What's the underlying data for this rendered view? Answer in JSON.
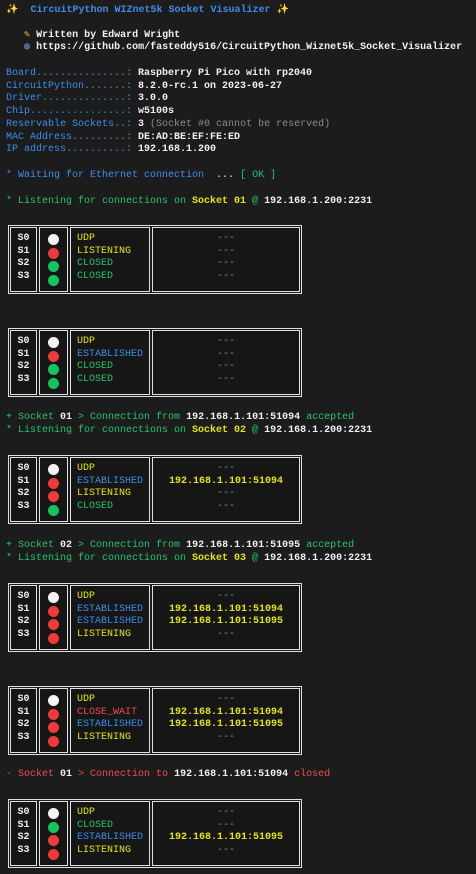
{
  "header": {
    "title": "CircuitPython WIZnet5k Socket Visualizer",
    "sparkle_icon": "sparkles",
    "author": "Written by Edward Wright",
    "pencil_icon": "pencil",
    "globe_icon": "globe",
    "url": "https://github.com/fasteddy516/CircuitPython_Wiznet5k_Socket_Visualizer"
  },
  "info": [
    {
      "label": "Board...............: ",
      "value": "Raspberry Pi Pico with rp2040",
      "note": ""
    },
    {
      "label": "CircuitPython.......: ",
      "value": "8.2.0-rc.1 on 2023-06-27",
      "note": ""
    },
    {
      "label": "Driver..............: ",
      "value": "3.0.0",
      "note": ""
    },
    {
      "label": "Chip................: ",
      "value": "w5100s",
      "note": ""
    },
    {
      "label": "Reservable Sockets..: ",
      "value": "3",
      "note": " (Socket #0 cannot be reserved)"
    },
    {
      "label": "MAC Address.........: ",
      "value": "DE:AD:BE:EF:FE:ED",
      "note": ""
    },
    {
      "label": "IP address..........: ",
      "value": "192.168.1.200",
      "note": ""
    }
  ],
  "waiting": {
    "text": "* Waiting for Ethernet connection ",
    "dots": " ... ",
    "ok": "[ OK ]"
  },
  "logs": [
    [
      {
        "t": "* Listening for connections on ",
        "c": "g"
      },
      {
        "t": "Socket 01",
        "c": "y"
      },
      {
        "t": " @ ",
        "c": "g"
      },
      {
        "t": "192.168.1.200:2231",
        "c": "w"
      }
    ],
    [
      {
        "t": "+ Socket ",
        "c": "g"
      },
      {
        "t": "01",
        "c": "w"
      },
      {
        "t": " > Connection from ",
        "c": "g"
      },
      {
        "t": "192.168.1.101:51094",
        "c": "w"
      },
      {
        "t": " accepted",
        "c": "g"
      }
    ],
    [
      {
        "t": "* Listening for connections on ",
        "c": "g"
      },
      {
        "t": "Socket 02",
        "c": "y"
      },
      {
        "t": " @ ",
        "c": "g"
      },
      {
        "t": "192.168.1.200:2231",
        "c": "w"
      }
    ],
    [
      {
        "t": "+ Socket ",
        "c": "g"
      },
      {
        "t": "02",
        "c": "w"
      },
      {
        "t": " > Connection from ",
        "c": "g"
      },
      {
        "t": "192.168.1.101:51095",
        "c": "w"
      },
      {
        "t": " accepted",
        "c": "g"
      }
    ],
    [
      {
        "t": "* Listening for connections on ",
        "c": "g"
      },
      {
        "t": "Socket 03",
        "c": "y"
      },
      {
        "t": " @ ",
        "c": "g"
      },
      {
        "t": "192.168.1.200:2231",
        "c": "w"
      }
    ],
    [
      {
        "t": "- Socket ",
        "c": "r"
      },
      {
        "t": "01",
        "c": "w"
      },
      {
        "t": " > Connection to ",
        "c": "r"
      },
      {
        "t": "192.168.1.101:51094",
        "c": "w"
      },
      {
        "t": " closed",
        "c": "r"
      }
    ]
  ],
  "colors": {
    "white": "#f5f5f5",
    "red": "#f03a3a",
    "green": "#14c45e",
    "UDP": "#e5e510",
    "LISTENING": "#e5e510",
    "CLOSED": "#23c46e",
    "ESTABLISHED": "#3b8eea",
    "CLOSE_WAIT": "#f14c4c"
  },
  "tables": [
    [
      [
        "S0",
        "white",
        "UDP",
        "---"
      ],
      [
        "S1",
        "red",
        "LISTENING",
        "---"
      ],
      [
        "S2",
        "green",
        "CLOSED",
        "---"
      ],
      [
        "S3",
        "green",
        "CLOSED",
        "---"
      ]
    ],
    [
      [
        "S0",
        "white",
        "UDP",
        "---"
      ],
      [
        "S1",
        "red",
        "ESTABLISHED",
        "---"
      ],
      [
        "S2",
        "green",
        "CLOSED",
        "---"
      ],
      [
        "S3",
        "green",
        "CLOSED",
        "---"
      ]
    ],
    [
      [
        "S0",
        "white",
        "UDP",
        "---"
      ],
      [
        "S1",
        "red",
        "ESTABLISHED",
        "192.168.1.101:51094"
      ],
      [
        "S2",
        "red",
        "LISTENING",
        "---"
      ],
      [
        "S3",
        "green",
        "CLOSED",
        "---"
      ]
    ],
    [
      [
        "S0",
        "white",
        "UDP",
        "---"
      ],
      [
        "S1",
        "red",
        "ESTABLISHED",
        "192.168.1.101:51094"
      ],
      [
        "S2",
        "red",
        "ESTABLISHED",
        "192.168.1.101:51095"
      ],
      [
        "S3",
        "red",
        "LISTENING",
        "---"
      ]
    ],
    [
      [
        "S0",
        "white",
        "UDP",
        "---"
      ],
      [
        "S1",
        "red",
        "CLOSE_WAIT",
        "192.168.1.101:51094"
      ],
      [
        "S2",
        "red",
        "ESTABLISHED",
        "192.168.1.101:51095"
      ],
      [
        "S3",
        "red",
        "LISTENING",
        "---"
      ]
    ],
    [
      [
        "S0",
        "white",
        "UDP",
        "---"
      ],
      [
        "S1",
        "green",
        "CLOSED",
        "---"
      ],
      [
        "S2",
        "red",
        "ESTABLISHED",
        "192.168.1.101:51095"
      ],
      [
        "S3",
        "red",
        "LISTENING",
        "---"
      ]
    ]
  ]
}
